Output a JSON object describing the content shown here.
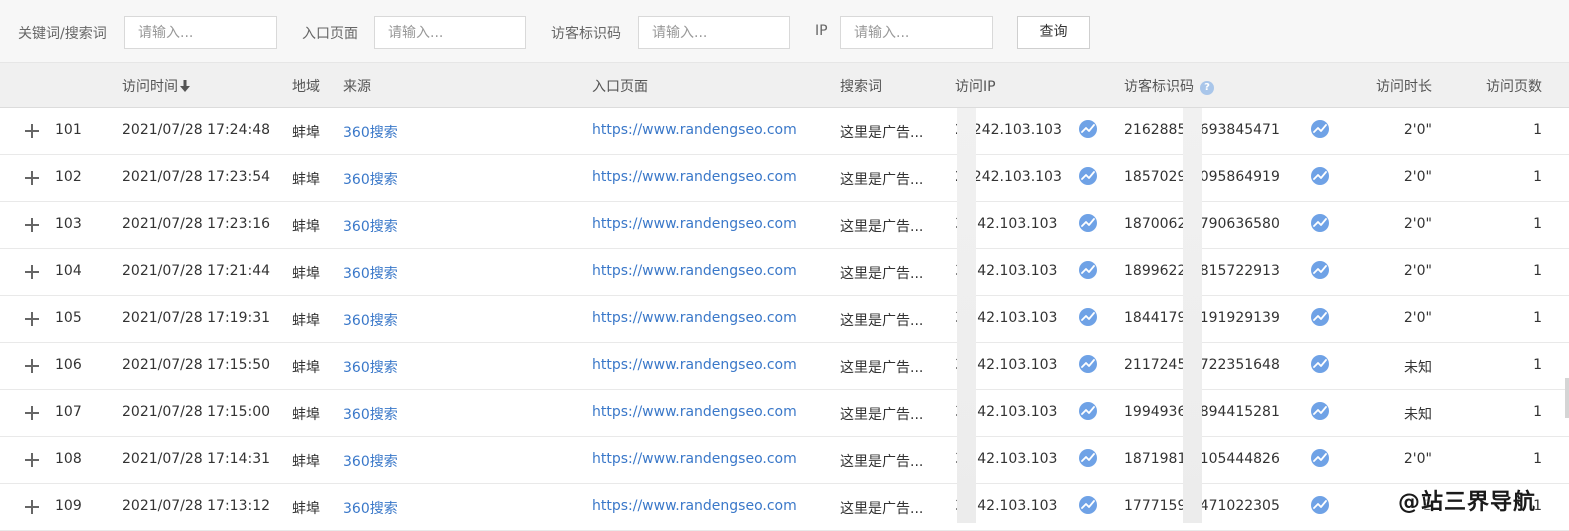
{
  "filters": {
    "keyword_label": "关键词/搜索词",
    "keyword_placeholder": "请输入...",
    "entry_label": "入口页面",
    "entry_placeholder": "请输入...",
    "visitor_label": "访客标识码",
    "visitor_placeholder": "请输入...",
    "ip_label": "IP",
    "ip_placeholder": "请输入...",
    "query_button": "查询"
  },
  "columns": {
    "time": "访问时间",
    "region": "地域",
    "source": "来源",
    "entry": "入口页面",
    "keyword": "搜索词",
    "ip": "访问IP",
    "visitor_id": "访客标识码",
    "duration": "访问时长",
    "pages": "访问页数"
  },
  "rows": [
    {
      "num": "101",
      "time": "2021/07/28 17:24:48",
      "region": "蚌埠",
      "source": "360搜索",
      "entry": "https://www.randengseo.com",
      "keyword": "这里是广告...",
      "ip": "2 .242.103.103",
      "visitor_id": "2162885 2693845471",
      "duration": "2'0\"",
      "pages": "1"
    },
    {
      "num": "102",
      "time": "2021/07/28 17:23:54",
      "region": "蚌埠",
      "source": "360搜索",
      "entry": "https://www.randengseo.com",
      "keyword": "这里是广告...",
      "ip": "2 .242.103.103",
      "visitor_id": "1857029 6095864919",
      "duration": "2'0\"",
      "pages": "1"
    },
    {
      "num": "103",
      "time": "2021/07/28 17:23:16",
      "region": "蚌埠",
      "source": "360搜索",
      "entry": "https://www.randengseo.com",
      "keyword": "这里是广告...",
      "ip": " 3.242.103.103",
      "visitor_id": "1870062 3790636580",
      "duration": "2'0\"",
      "pages": "1"
    },
    {
      "num": "104",
      "time": "2021/07/28 17:21:44",
      "region": "蚌埠",
      "source": "360搜索",
      "entry": "https://www.randengseo.com",
      "keyword": "这里是广告...",
      "ip": " 3.242.103.103",
      "visitor_id": "1899622 4815722913",
      "duration": "2'0\"",
      "pages": "1"
    },
    {
      "num": "105",
      "time": "2021/07/28 17:19:31",
      "region": "蚌埠",
      "source": "360搜索",
      "entry": "https://www.randengseo.com",
      "keyword": "这里是广告...",
      "ip": " 3.242.103.103",
      "visitor_id": "1844179 6191929139",
      "duration": "2'0\"",
      "pages": "1"
    },
    {
      "num": "106",
      "time": "2021/07/28 17:15:50",
      "region": "蚌埠",
      "source": "360搜索",
      "entry": "https://www.randengseo.com",
      "keyword": "这里是广告...",
      "ip": " 3.242.103.103",
      "visitor_id": "2117245 6722351648",
      "duration": "未知",
      "pages": "1"
    },
    {
      "num": "107",
      "time": "2021/07/28 17:15:00",
      "region": "蚌埠",
      "source": "360搜索",
      "entry": "https://www.randengseo.com",
      "keyword": "这里是广告...",
      "ip": " 3.242.103.103",
      "visitor_id": "1994936 4894415281",
      "duration": "未知",
      "pages": "1"
    },
    {
      "num": "108",
      "time": "2021/07/28 17:14:31",
      "region": "蚌埠",
      "source": "360搜索",
      "entry": "https://www.randengseo.com",
      "keyword": "这里是广告...",
      "ip": " 3.242.103.103",
      "visitor_id": "1871981 9105444826",
      "duration": "2'0\"",
      "pages": "1"
    },
    {
      "num": "109",
      "time": "2021/07/28 17:13:12",
      "region": "蚌埠",
      "source": "360搜索",
      "entry": "https://www.randengseo.com",
      "keyword": "这里是广告...",
      "ip": " 3.242.103.103",
      "visitor_id": "1777159 8471022305",
      "duration": "2",
      "pages": "1"
    }
  ],
  "watermark": "@站三界导航",
  "icons": {
    "expand": "plus-icon",
    "trend": "trend-chart-icon",
    "sort": "sort-down-arrow-icon",
    "help": "help-circle-icon"
  },
  "colors": {
    "link": "#3a78c9",
    "trend_icon": "#6fa2e6",
    "header_bg": "#f0f0f0",
    "filter_bg": "#f7f7f7"
  }
}
